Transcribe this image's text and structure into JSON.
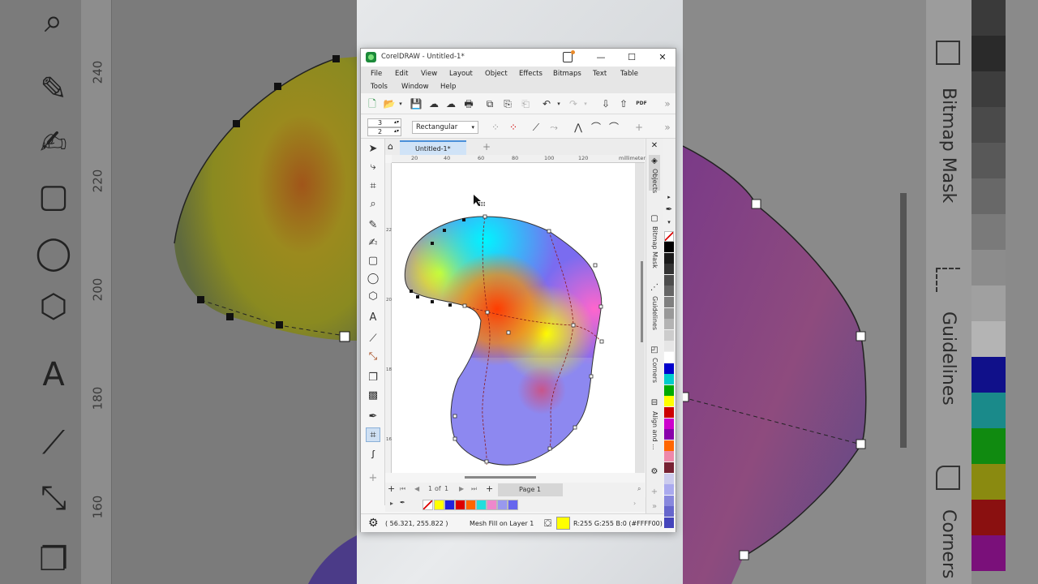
{
  "background": {
    "left_ruler_ticks": [
      "240",
      "220",
      "200",
      "180",
      "160"
    ],
    "right_labels": [
      "Bitmap Mask",
      "Guidelines",
      "Corners"
    ]
  },
  "window": {
    "title": "CorelDRAW - Untitled-1*",
    "controls": {
      "minimize": "—",
      "maximize": "☐",
      "close": "✕"
    }
  },
  "menu": [
    "File",
    "Edit",
    "View",
    "Layout",
    "Object",
    "Effects",
    "Bitmaps",
    "Text",
    "Table",
    "Tools",
    "Window",
    "Help"
  ],
  "property_bar": {
    "rows_value": "3",
    "cols_value": "2",
    "shape_mode": "Rectangular"
  },
  "document": {
    "tab_label": "Untitled-1*",
    "ruler_unit": "millimeters",
    "h_ruler_ticks": [
      "20",
      "40",
      "60",
      "80",
      "100",
      "120"
    ],
    "v_ruler_ticks": [
      "220",
      "200",
      "180",
      "160"
    ],
    "v_ruler_unit": "millimeters"
  },
  "page_nav": {
    "current": "1",
    "of_label": "of",
    "total": "1",
    "page_tab": "Page 1"
  },
  "document_palette": [
    "#ffff00",
    "#2222dd",
    "#dd0000",
    "#ff6600",
    "#22dddd",
    "#ee88cc",
    "#9999ee",
    "#6666ee"
  ],
  "status": {
    "cursor_coords": "( 56.321, 255.822 )",
    "object_info": "Mesh Fill on Layer 1",
    "fill_color": "#ffff00",
    "fill_text": "R:255 G:255 B:0 (#FFFF00)"
  },
  "dockers": [
    "Objects",
    "Bitmap Mask",
    "Guidelines",
    "Corners",
    "Align and ..."
  ],
  "color_palette": [
    "#000000",
    "#1a1a1a",
    "#333333",
    "#4d4d4d",
    "#666666",
    "#808080",
    "#999999",
    "#b3b3b3",
    "#cccccc",
    "#e6e6e6",
    "#ffffff",
    "#0000cc",
    "#00cccc",
    "#00aa00",
    "#ffff00",
    "#cc0000",
    "#cc00cc",
    "#8800aa",
    "#ff6600",
    "#ee88aa",
    "#772233",
    "#ccccee",
    "#aaaaee",
    "#8888dd",
    "#6666cc",
    "#4444bb"
  ]
}
